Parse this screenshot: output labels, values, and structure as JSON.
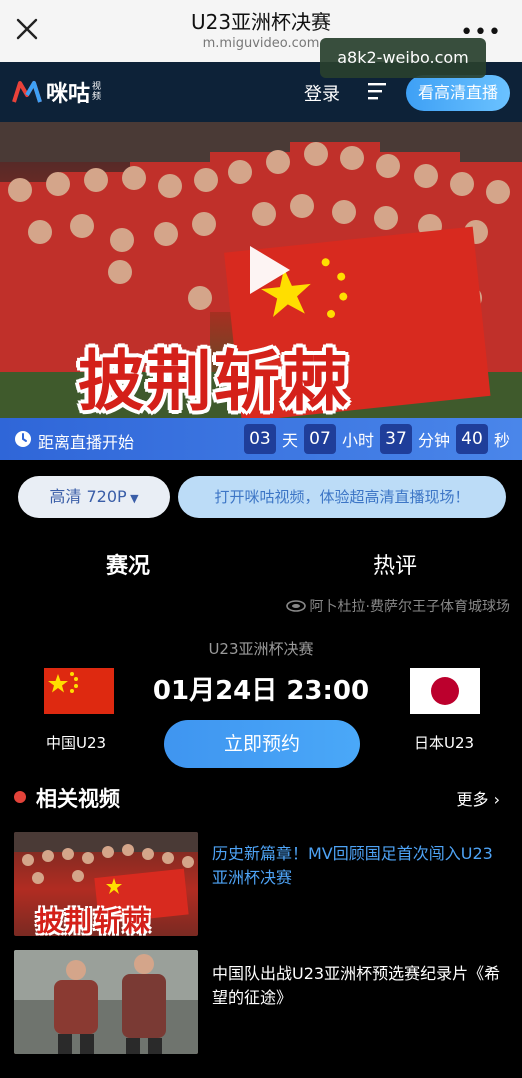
{
  "browser": {
    "title": "U23亚洲杯决赛",
    "url": "m.miguvideo.com",
    "watermark": "a8k2-weibo.com"
  },
  "header": {
    "logo_text": "咪咕",
    "logo_sub": "视频",
    "login_label": "登录",
    "hd_live_label": "看高清直播"
  },
  "banner": {
    "caption": "披荆斩棘",
    "colors": {
      "flag_red": "#d82a1f",
      "caption_red": "#d42019"
    }
  },
  "countdown": {
    "label": "距离直播开始",
    "days": "03",
    "days_unit": "天",
    "hours": "07",
    "hours_unit": "小时",
    "minutes": "37",
    "minutes_unit": "分钟",
    "seconds": "40",
    "seconds_unit": "秒"
  },
  "quality": {
    "selected": "高清 720P",
    "promo": "打开咪咕视频，体验超高清直播现场！"
  },
  "tabs": [
    {
      "label": "赛况",
      "active": true
    },
    {
      "label": "热评",
      "active": false
    }
  ],
  "match": {
    "venue": "阿卜杜拉·费萨尔王子体育城球场",
    "title": "U23亚洲杯决赛",
    "time": "01月24日 23:00",
    "home_team": "中国U23",
    "away_team": "日本U23",
    "reserve_label": "立即预约"
  },
  "related": {
    "title": "相关视频",
    "more_label": "更多 ›",
    "videos": [
      {
        "title": "历史新篇章！MV回顾国足首次闯入U23亚洲杯决赛",
        "thumb_caption": "披荆斩棘"
      },
      {
        "title": "中国队出战U23亚洲杯预选赛纪录片《希望的征途》"
      }
    ]
  },
  "colors": {
    "accent_blue": "#4aa8f8",
    "header_bg": "#0d2238",
    "countdown_bg": "#2f66d8",
    "link_blue": "#4ea3f5",
    "dot_red": "#e3433a"
  }
}
